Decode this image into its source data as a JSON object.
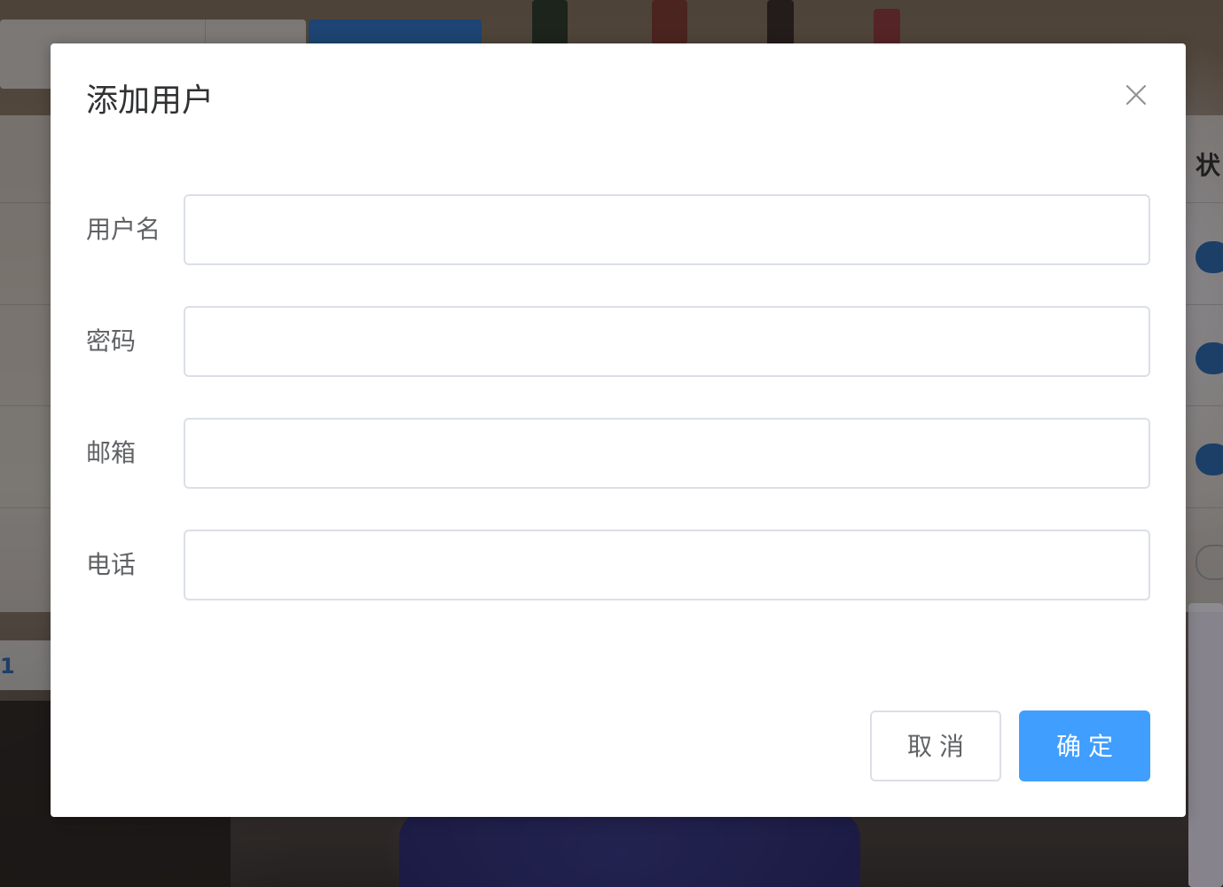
{
  "background": {
    "column_header": "状",
    "pager_current": "1"
  },
  "dialog": {
    "title": "添加用户",
    "close_icon": "close-icon",
    "fields": [
      {
        "label": "用户名",
        "value": "",
        "placeholder": ""
      },
      {
        "label": "密码",
        "value": "",
        "placeholder": ""
      },
      {
        "label": "邮箱",
        "value": "",
        "placeholder": ""
      },
      {
        "label": "电话",
        "value": "",
        "placeholder": ""
      }
    ],
    "buttons": {
      "cancel": "取消",
      "confirm": "确定"
    }
  },
  "colors": {
    "primary": "#409eff",
    "overlay": "rgba(0,0,0,0.38)",
    "input_border": "#dcdfe6",
    "label_text": "#606266",
    "title_text": "#303133"
  }
}
